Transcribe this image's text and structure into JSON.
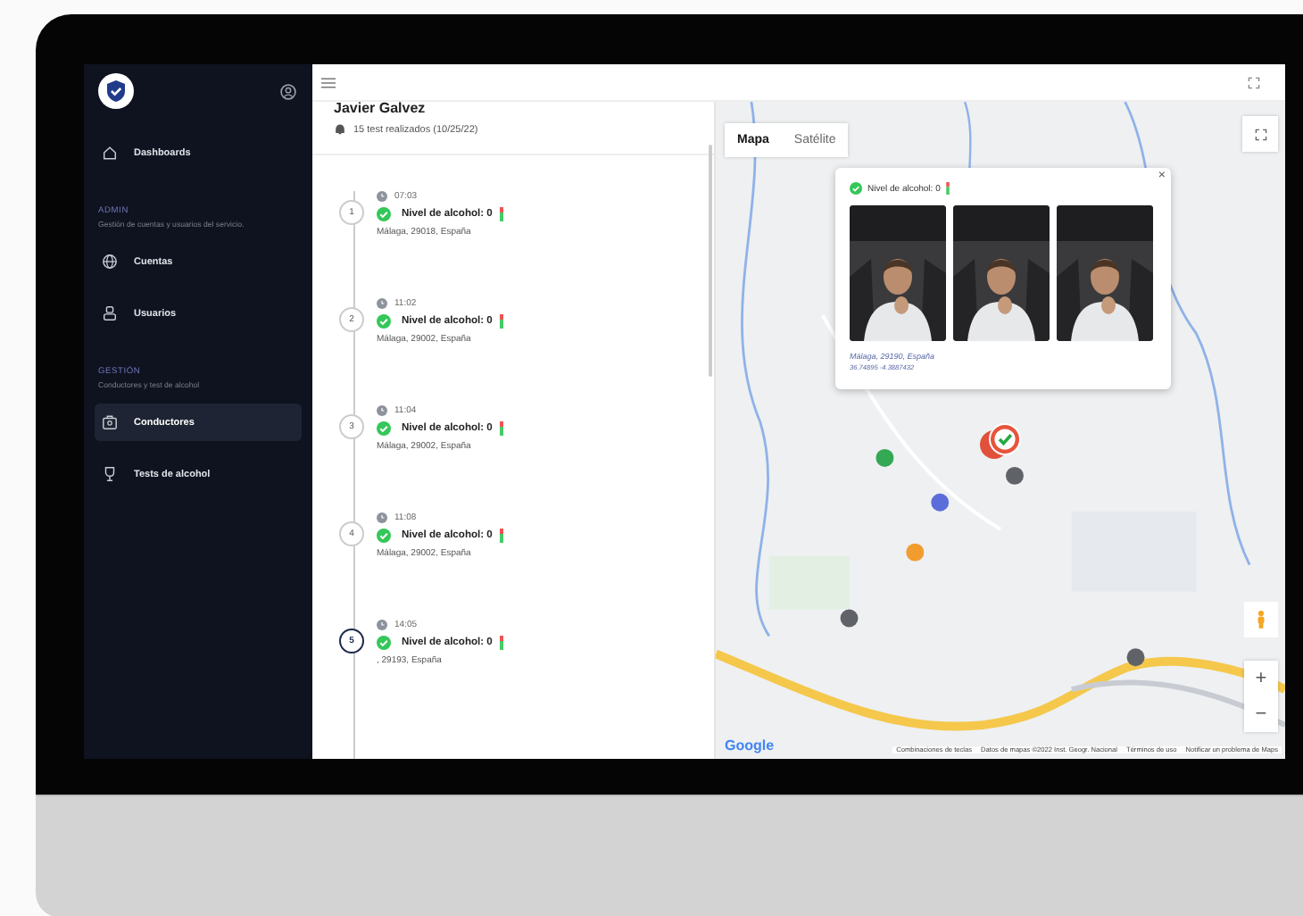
{
  "sidebar": {
    "nav": [
      {
        "kind": "item",
        "label": "Dashboards",
        "selected": false
      },
      {
        "kind": "section",
        "title": "ADMIN",
        "description": "Gestión de cuentas y usuarios del servicio."
      },
      {
        "kind": "item",
        "label": "Cuentas",
        "selected": false
      },
      {
        "kind": "item",
        "label": "Usuarios",
        "selected": false
      },
      {
        "kind": "section",
        "title": "GESTIÓN",
        "description": "Conductores y test de alcohol"
      },
      {
        "kind": "item",
        "label": "Conductores",
        "selected": true
      },
      {
        "kind": "item",
        "label": "Tests de alcohol",
        "selected": false
      }
    ]
  },
  "driver": {
    "name": "Javier Galvez",
    "summary": "15 test realizados (10/25/22)"
  },
  "tests": [
    {
      "number": "1",
      "time": "07:03",
      "result": "Nivel de alcohol: 0",
      "location": "Málaga, 29018, España",
      "selected": false
    },
    {
      "number": "2",
      "time": "11:02",
      "result": "Nivel de alcohol: 0",
      "location": "Málaga, 29002, España",
      "selected": false
    },
    {
      "number": "3",
      "time": "11:04",
      "result": "Nivel de alcohol: 0",
      "location": "Málaga, 29002, España",
      "selected": false
    },
    {
      "number": "4",
      "time": "11:08",
      "result": "Nivel de alcohol: 0",
      "location": "Málaga, 29002, España",
      "selected": false
    },
    {
      "number": "5",
      "time": "14:05",
      "result": "Nivel de alcohol: 0",
      "location": ", 29193, España",
      "selected": true
    }
  ],
  "map": {
    "tabs": [
      {
        "label": "Mapa",
        "selected": true
      },
      {
        "label": "Satélite",
        "selected": false
      }
    ],
    "popup": {
      "result": "Nivel de alcohol: 0",
      "close": "×",
      "location": "Málaga, 29190, España",
      "coordinates": "36.74895 -4.3887432"
    },
    "zoom": [
      "+",
      "−"
    ],
    "logo": "Google",
    "attribution": [
      "Combinaciones de teclas",
      "Datos de mapas ©2022 Inst. Geogr. Nacional",
      "Términos de uso",
      "Notificar un problema de Maps"
    ]
  }
}
